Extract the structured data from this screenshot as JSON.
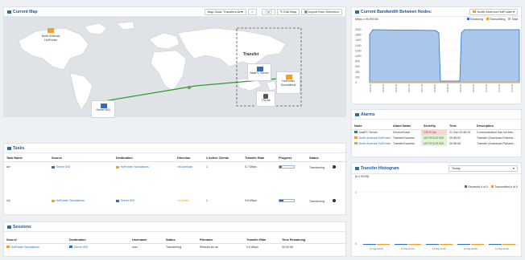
{
  "current_map": {
    "title": "Current Map",
    "map_select": "Map Data: Transfers America Asia",
    "edit_map": "Edit Map",
    "import_label": "Import from Selection",
    "nodes": [
      {
        "label": "North America\nHotFolder"
      },
      {
        "label": "Server 603"
      },
      {
        "label": "AsiaFC Server"
      },
      {
        "label": "HotFolder\nSimulations"
      },
      {
        "label": "TSLink"
      }
    ],
    "group_label": "Transfer"
  },
  "bandwidth": {
    "title": "Current Bandwidth Between Nodes:",
    "select": "North America HotFolder",
    "unit_label": "Mbps x 99.999.55",
    "legend": [
      {
        "name": "Receiving",
        "color": "#2a6fc9"
      },
      {
        "name": "Transmitting",
        "color": "#f39a1e"
      },
      {
        "name": "Total",
        "color": "#b5b5b5"
      }
    ],
    "y_ticks": [
      "2000",
      "1800",
      "1600",
      "1400",
      "1200",
      "1000",
      "800",
      "600",
      "400",
      "200",
      "0"
    ]
  },
  "alarms": {
    "title": "Alarms",
    "columns": [
      "Node",
      "Alarm Name",
      "Severity",
      "Time",
      "Description"
    ],
    "rows": [
      {
        "node": "AsiaFC Server",
        "alarm": "ServiceDown",
        "severity": "CRITICAL",
        "time": "21 Sep 10:46:15",
        "desc": "Communication has not bee..."
      },
      {
        "node": "North America HotFolder",
        "alarm": "TransferSuccess",
        "severity": "NOTIFICATION",
        "time": "09:55:02",
        "desc": "Transfer (Download Entered..."
      },
      {
        "node": "North America HotFolder",
        "alarm": "TransferSuccess",
        "severity": "NOTIFICATION",
        "time": "09:56:46",
        "desc": "Transfer (Download Pictures..."
      }
    ]
  },
  "histogram": {
    "title": "Transfer Histogram",
    "select": "Today",
    "unit_label": "(# x 00:05)",
    "legend": [
      {
        "name": "Received # of 0",
        "color": "#2a6fc9"
      },
      {
        "name": "Transmitted # of 0",
        "color": "#f39a1e"
      }
    ],
    "x_labels": [
      "14 Sep 00:30",
      "14 Sep 01:00",
      "14 Sep 01:30",
      "14 Sep 02:00",
      "14 Sep 02:30"
    ]
  },
  "tasks": {
    "title": "Tasks",
    "columns": [
      "Task Name",
      "Source",
      "Destination",
      "Direction",
      "# Active Clients",
      "Transfer Rate",
      "Progress",
      "Status"
    ],
    "rows": [
      {
        "name": "dw",
        "source": "Server 603",
        "dest": "HotFolder Simulations",
        "direction": "Download",
        "clients": "1",
        "rate": "0.7 Mbps",
        "progress": 0.18,
        "status": "Transferring"
      },
      {
        "name": "Up",
        "source": "HotFolder Simulations",
        "dest": "Server 603",
        "direction": "Upload",
        "clients": "1",
        "rate": "0.6 Mbps",
        "progress": 0.3,
        "status": "Transferring"
      }
    ]
  },
  "sessions": {
    "title": "Sessions",
    "columns": [
      "Source",
      "Destination",
      "Username",
      "Status",
      "Filename",
      "Transfer Rate",
      "Time Remaining"
    ],
    "rows": [
      {
        "source": "HotFolder Simulations",
        "dest": "Server 603",
        "user": "user",
        "status": "Transferring",
        "file": "Reiouks.tst.rar",
        "rate": "0.5 Mbps",
        "remaining": "00:00:06"
      }
    ]
  }
}
